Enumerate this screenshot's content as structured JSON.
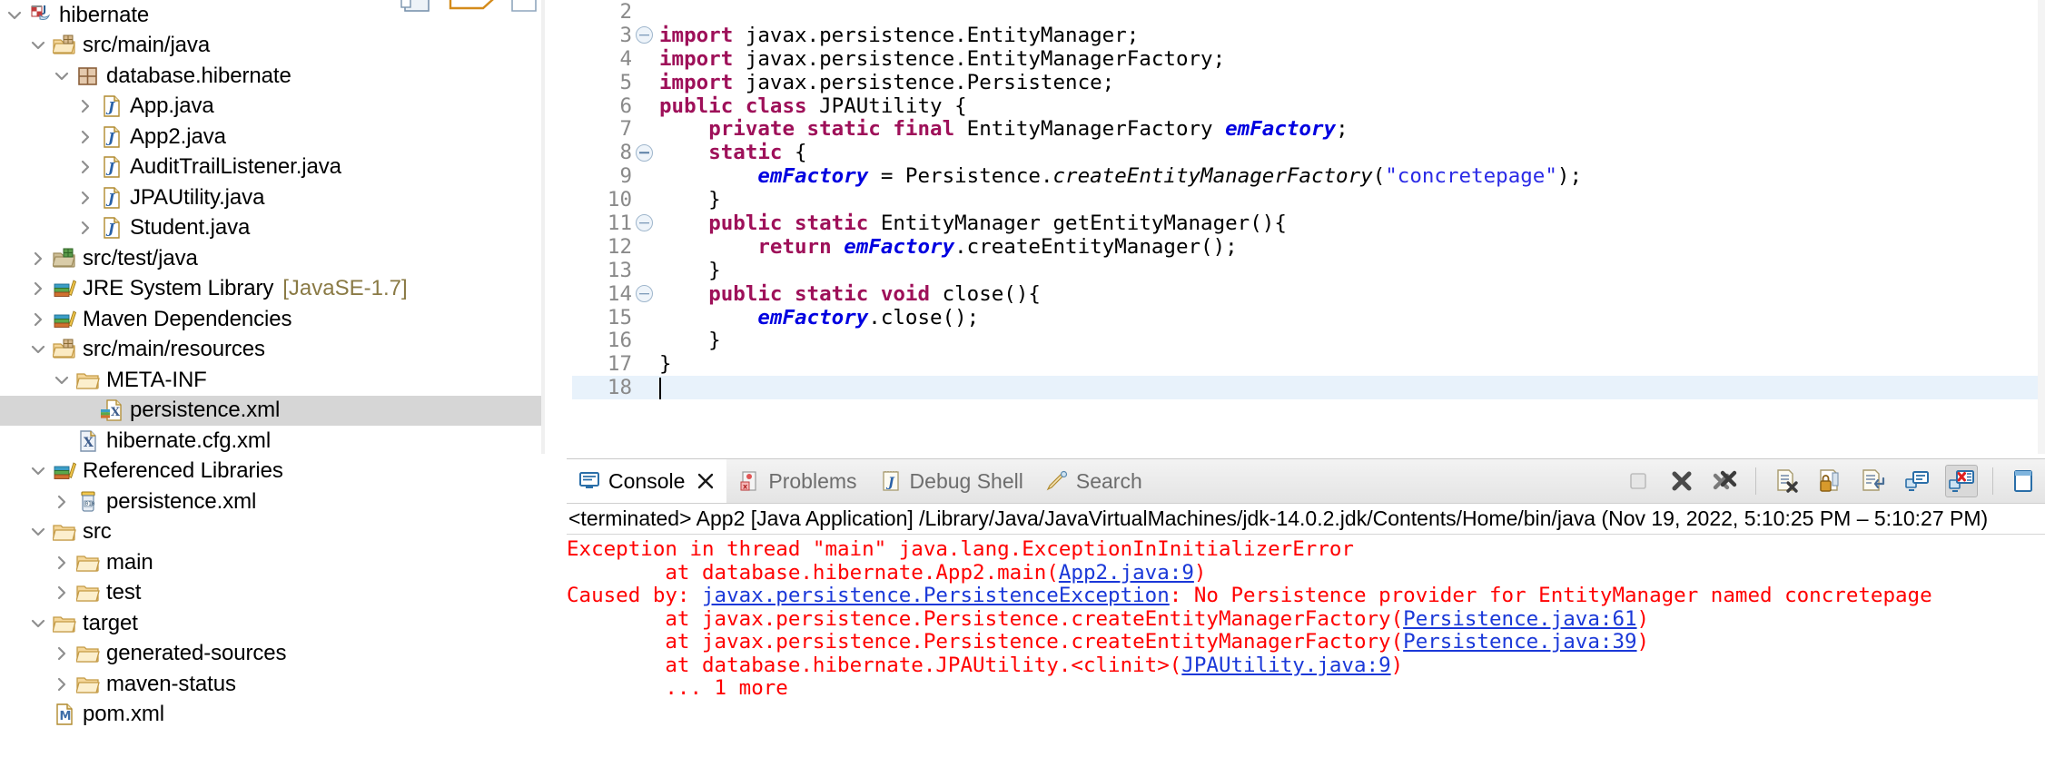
{
  "explorer": {
    "name": "package-explorer",
    "tree": [
      {
        "label": "hibernate",
        "indent": 0,
        "twisty": "down",
        "icon": "maven-java-project-icon",
        "selected": false
      },
      {
        "label": "src/main/java",
        "indent": 1,
        "twisty": "down",
        "icon": "source-folder-icon",
        "selected": false
      },
      {
        "label": "database.hibernate",
        "indent": 2,
        "twisty": "down",
        "icon": "package-icon",
        "selected": false
      },
      {
        "label": "App.java",
        "indent": 3,
        "twisty": "right",
        "icon": "java-file-icon",
        "selected": false
      },
      {
        "label": "App2.java",
        "indent": 3,
        "twisty": "right",
        "icon": "java-file-icon",
        "selected": false
      },
      {
        "label": "AuditTrailListener.java",
        "indent": 3,
        "twisty": "right",
        "icon": "java-file-icon",
        "selected": false
      },
      {
        "label": "JPAUtility.java",
        "indent": 3,
        "twisty": "right",
        "icon": "java-file-icon",
        "selected": false
      },
      {
        "label": "Student.java",
        "indent": 3,
        "twisty": "right",
        "icon": "java-file-icon",
        "selected": false
      },
      {
        "label": "src/test/java",
        "indent": 1,
        "twisty": "right",
        "icon": "test-source-folder-icon",
        "selected": false
      },
      {
        "label": "JRE System Library",
        "suffix": "[JavaSE-1.7]",
        "indent": 1,
        "twisty": "right",
        "icon": "library-icon",
        "selected": false
      },
      {
        "label": "Maven Dependencies",
        "indent": 1,
        "twisty": "right",
        "icon": "library-icon",
        "selected": false
      },
      {
        "label": "src/main/resources",
        "indent": 1,
        "twisty": "down",
        "icon": "source-folder-icon",
        "selected": false
      },
      {
        "label": "META-INF",
        "indent": 2,
        "twisty": "down",
        "icon": "folder-icon",
        "selected": false
      },
      {
        "label": "persistence.xml",
        "indent": 3,
        "twisty": "none",
        "icon": "persistence-xml-icon",
        "selected": true
      },
      {
        "label": "hibernate.cfg.xml",
        "indent": 2,
        "twisty": "none",
        "icon": "xml-file-icon",
        "selected": false
      },
      {
        "label": "Referenced Libraries",
        "indent": 1,
        "twisty": "down",
        "icon": "library-icon",
        "selected": false
      },
      {
        "label": "persistence.xml",
        "indent": 2,
        "twisty": "right",
        "icon": "jar-icon",
        "selected": false
      },
      {
        "label": "src",
        "indent": 1,
        "twisty": "down",
        "icon": "folder-icon",
        "selected": false
      },
      {
        "label": "main",
        "indent": 2,
        "twisty": "right",
        "icon": "folder-icon",
        "selected": false
      },
      {
        "label": "test",
        "indent": 2,
        "twisty": "right",
        "icon": "folder-icon",
        "selected": false
      },
      {
        "label": "target",
        "indent": 1,
        "twisty": "down",
        "icon": "folder-icon",
        "selected": false
      },
      {
        "label": "generated-sources",
        "indent": 2,
        "twisty": "right",
        "icon": "folder-icon",
        "selected": false
      },
      {
        "label": "maven-status",
        "indent": 2,
        "twisty": "right",
        "icon": "folder-icon",
        "selected": false
      },
      {
        "label": "pom.xml",
        "indent": 1,
        "twisty": "none",
        "icon": "maven-pom-icon",
        "selected": false
      }
    ]
  },
  "editor": {
    "name": "java-editor",
    "first_visible_line": 2,
    "cursor_line": 18,
    "lines": [
      {
        "no": 2,
        "fold": false,
        "tokens": []
      },
      {
        "no": 3,
        "fold": true,
        "tokens": [
          {
            "t": "kw",
            "v": "import"
          },
          {
            "t": "pl",
            "v": " javax.persistence.EntityManager;"
          }
        ]
      },
      {
        "no": 4,
        "fold": false,
        "tokens": [
          {
            "t": "kw",
            "v": "import"
          },
          {
            "t": "pl",
            "v": " javax.persistence.EntityManagerFactory;"
          }
        ]
      },
      {
        "no": 5,
        "fold": false,
        "tokens": [
          {
            "t": "kw",
            "v": "import"
          },
          {
            "t": "pl",
            "v": " javax.persistence.Persistence;"
          }
        ]
      },
      {
        "no": 6,
        "fold": false,
        "tokens": [
          {
            "t": "kw",
            "v": "public class"
          },
          {
            "t": "pl",
            "v": " JPAUtility {"
          }
        ]
      },
      {
        "no": 7,
        "fold": false,
        "tokens": [
          {
            "t": "pl",
            "v": "    "
          },
          {
            "t": "kw",
            "v": "private static final"
          },
          {
            "t": "pl",
            "v": " EntityManagerFactory "
          },
          {
            "t": "fld",
            "v": "emFactory"
          },
          {
            "t": "pl",
            "v": ";"
          }
        ]
      },
      {
        "no": 8,
        "fold": true,
        "tokens": [
          {
            "t": "pl",
            "v": "    "
          },
          {
            "t": "kw",
            "v": "static"
          },
          {
            "t": "pl",
            "v": " {"
          }
        ]
      },
      {
        "no": 9,
        "fold": false,
        "tokens": [
          {
            "t": "pl",
            "v": "        "
          },
          {
            "t": "fld",
            "v": "emFactory"
          },
          {
            "t": "pl",
            "v": " = Persistence."
          },
          {
            "t": "mth",
            "v": "createEntityManagerFactory"
          },
          {
            "t": "pl",
            "v": "("
          },
          {
            "t": "str",
            "v": "\"concretepage\""
          },
          {
            "t": "pl",
            "v": ");"
          }
        ]
      },
      {
        "no": 10,
        "fold": false,
        "tokens": [
          {
            "t": "pl",
            "v": "    }"
          }
        ]
      },
      {
        "no": 11,
        "fold": true,
        "tokens": [
          {
            "t": "pl",
            "v": "    "
          },
          {
            "t": "kw",
            "v": "public static"
          },
          {
            "t": "pl",
            "v": " EntityManager getEntityManager(){"
          }
        ]
      },
      {
        "no": 12,
        "fold": false,
        "tokens": [
          {
            "t": "pl",
            "v": "        "
          },
          {
            "t": "kw",
            "v": "return"
          },
          {
            "t": "pl",
            "v": " "
          },
          {
            "t": "fld",
            "v": "emFactory"
          },
          {
            "t": "pl",
            "v": ".createEntityManager();"
          }
        ]
      },
      {
        "no": 13,
        "fold": false,
        "tokens": [
          {
            "t": "pl",
            "v": "    }"
          }
        ]
      },
      {
        "no": 14,
        "fold": true,
        "tokens": [
          {
            "t": "pl",
            "v": "    "
          },
          {
            "t": "kw",
            "v": "public static void"
          },
          {
            "t": "pl",
            "v": " close(){"
          }
        ]
      },
      {
        "no": 15,
        "fold": false,
        "tokens": [
          {
            "t": "pl",
            "v": "        "
          },
          {
            "t": "fld",
            "v": "emFactory"
          },
          {
            "t": "pl",
            "v": ".close();"
          }
        ]
      },
      {
        "no": 16,
        "fold": false,
        "tokens": [
          {
            "t": "pl",
            "v": "    }"
          }
        ]
      },
      {
        "no": 17,
        "fold": false,
        "tokens": [
          {
            "t": "pl",
            "v": "}"
          }
        ]
      },
      {
        "no": 18,
        "fold": false,
        "tokens": [],
        "cursor": true
      }
    ]
  },
  "console": {
    "name": "console-view",
    "tabs": [
      {
        "label": "Console",
        "icon": "console-icon",
        "active": true,
        "closable": true
      },
      {
        "label": "Problems",
        "icon": "problems-icon",
        "active": false,
        "closable": false
      },
      {
        "label": "Debug Shell",
        "icon": "debug-shell-icon",
        "active": false,
        "closable": false
      },
      {
        "label": "Search",
        "icon": "search-icon",
        "active": false,
        "closable": false
      }
    ],
    "toolbar": [
      {
        "name": "terminate-button",
        "icon": "stop-square-icon",
        "pressed": false
      },
      {
        "name": "remove-launch-button",
        "icon": "x-icon",
        "pressed": false
      },
      {
        "name": "remove-all-launches-button",
        "icon": "xx-icon",
        "pressed": false
      },
      {
        "name": "clear-console-button",
        "icon": "clear-console-icon",
        "pressed": false
      },
      {
        "name": "scroll-lock-button",
        "icon": "lock-icon",
        "pressed": false
      },
      {
        "name": "word-wrap-button",
        "icon": "word-wrap-icon",
        "pressed": false
      },
      {
        "name": "display-selected-console-button",
        "icon": "display-console-icon",
        "pressed": false
      },
      {
        "name": "open-console-button",
        "icon": "open-console-error-icon",
        "pressed": true
      },
      {
        "name": "pin-console-button",
        "icon": "pin-console-icon",
        "pressed": false
      }
    ],
    "header": "<terminated> App2 [Java Application] /Library/Java/JavaVirtualMachines/jdk-14.0.2.jdk/Contents/Home/bin/java  (Nov 19, 2022, 5:10:25 PM – 5:10:27 PM)",
    "output": [
      {
        "segments": [
          {
            "t": "err",
            "v": "Exception in thread \"main\" java.lang.ExceptionInInitializerError"
          }
        ]
      },
      {
        "segments": [
          {
            "t": "err",
            "v": "\tat database.hibernate.App2.main("
          },
          {
            "t": "link",
            "v": "App2.java:9"
          },
          {
            "t": "err",
            "v": ")"
          }
        ]
      },
      {
        "segments": [
          {
            "t": "err",
            "v": "Caused by: "
          },
          {
            "t": "link",
            "v": "javax.persistence.PersistenceException"
          },
          {
            "t": "err",
            "v": ": No Persistence provider for EntityManager named concretepage"
          }
        ]
      },
      {
        "segments": [
          {
            "t": "err",
            "v": "\tat javax.persistence.Persistence.createEntityManagerFactory("
          },
          {
            "t": "link",
            "v": "Persistence.java:61"
          },
          {
            "t": "err",
            "v": ")"
          }
        ]
      },
      {
        "segments": [
          {
            "t": "err",
            "v": "\tat javax.persistence.Persistence.createEntityManagerFactory("
          },
          {
            "t": "link",
            "v": "Persistence.java:39"
          },
          {
            "t": "err",
            "v": ")"
          }
        ]
      },
      {
        "segments": [
          {
            "t": "err",
            "v": "\tat database.hibernate.JPAUtility.<clinit>("
          },
          {
            "t": "link",
            "v": "JPAUtility.java:9"
          },
          {
            "t": "err",
            "v": ")"
          }
        ]
      },
      {
        "segments": [
          {
            "t": "err",
            "v": "\t... 1 more"
          }
        ]
      }
    ]
  },
  "colors": {
    "error_red": "#ff0000",
    "link_blue": "#1a38d8",
    "keyword_magenta": "#9e1059",
    "field_blue": "#0000e0",
    "string_blue": "#2a2ae6",
    "selection_gray": "#d6d6d6",
    "cursor_line": "#e8f2fb",
    "suffix_tan": "#8a7a45"
  }
}
